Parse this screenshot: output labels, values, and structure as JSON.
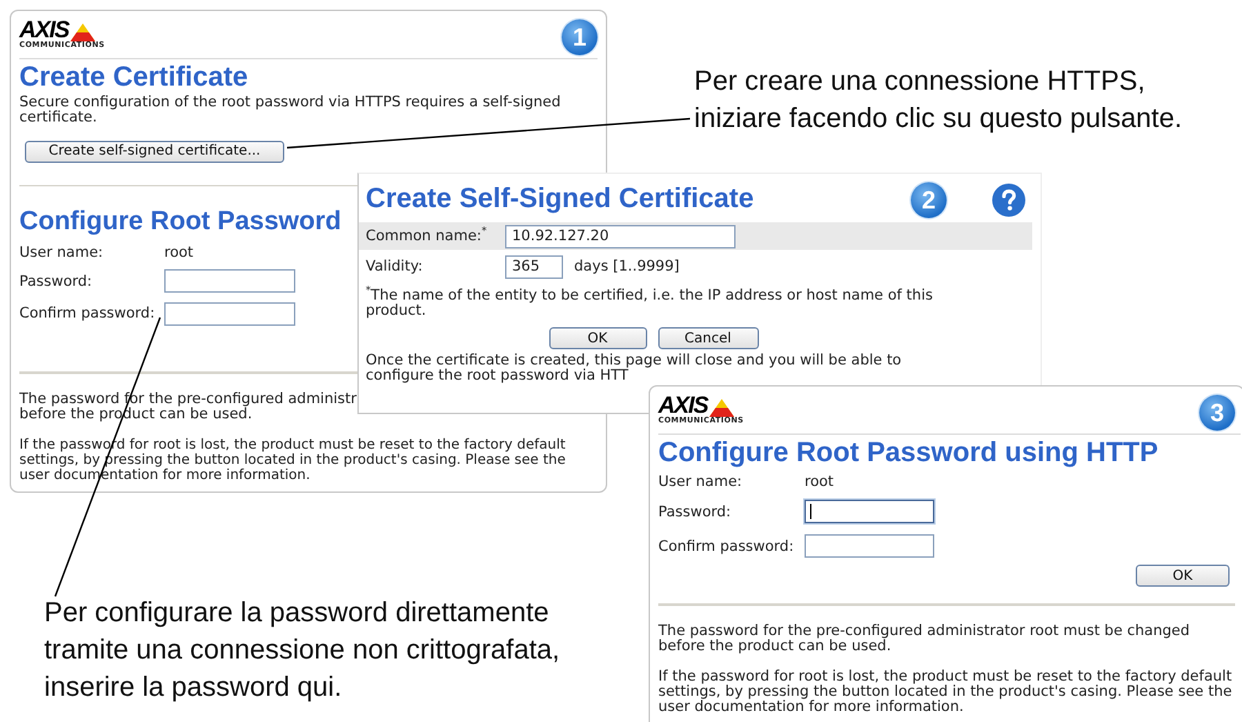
{
  "certificate_page": {
    "logo": {
      "name": "AXIS",
      "tagline": "COMMUNICATIONS"
    },
    "step": "1",
    "title": "Create Certificate",
    "description": "Secure configuration of the root password via HTTPS requires a self-signed certificate.",
    "button": "Create self-signed certificate...",
    "password_section": {
      "title": "Configure Root Password",
      "user_label": "User name:",
      "user_value": "root",
      "fields": [
        {
          "label": "Password:"
        },
        {
          "label": "Confirm password:"
        }
      ]
    },
    "first_note_lines": [
      "The password for the pre-configured administr",
      "before the product can be used."
    ],
    "second_note": "If the password for root is lost, the product must be reset to the factory default settings, by pressing the button located in the product's casing. Please see the user documentation for more information."
  },
  "certificate_dialog": {
    "title": "Create Self-Signed Certificate",
    "step": "2",
    "fields": [
      {
        "label": "Common name:$^{*}$",
        "value": "10.92.127.20",
        "kind": "wide",
        "shaded": true
      },
      {
        "label": "Validity:",
        "value": "365",
        "kind": "short",
        "unit": "days [1..9999]",
        "shaded": false
      }
    ],
    "footnote": "$^{*}$The name of the entity to be certified, i.e. the IP address or host name of this product.",
    "buttons": [
      "OK",
      "Cancel"
    ],
    "message_lines": [
      "Once the certificate is created, this page will close and you will be able to",
      "configure the root password via HTT"
    ]
  },
  "http_password_page": {
    "logo": {
      "name": "AXIS",
      "tagline": "COMMUNICATIONS"
    },
    "step": "3",
    "title": "Configure Root Password using HTTP",
    "user_label": "User name:",
    "user_value": "root",
    "fields": [
      {
        "label": "Password:",
        "focused": true
      },
      {
        "label": "Confirm password:",
        "focused": false
      }
    ],
    "button": "OK",
    "notes": [
      "The password for the pre-configured administrator root must be changed before the product can be used.",
      "If the password for root is lost, the product must be reset to the factory default settings, by pressing the button located in the product's casing. Please see the user documentation for more information."
    ]
  },
  "callouts": [
    {
      "text": "Per creare una connessione HTTPS, iniziare facendo clic su questo pulsante."
    },
    {
      "text": "Per configurare la password direttamente tramite una connessione non crittografata, inserire la password qui."
    }
  ]
}
